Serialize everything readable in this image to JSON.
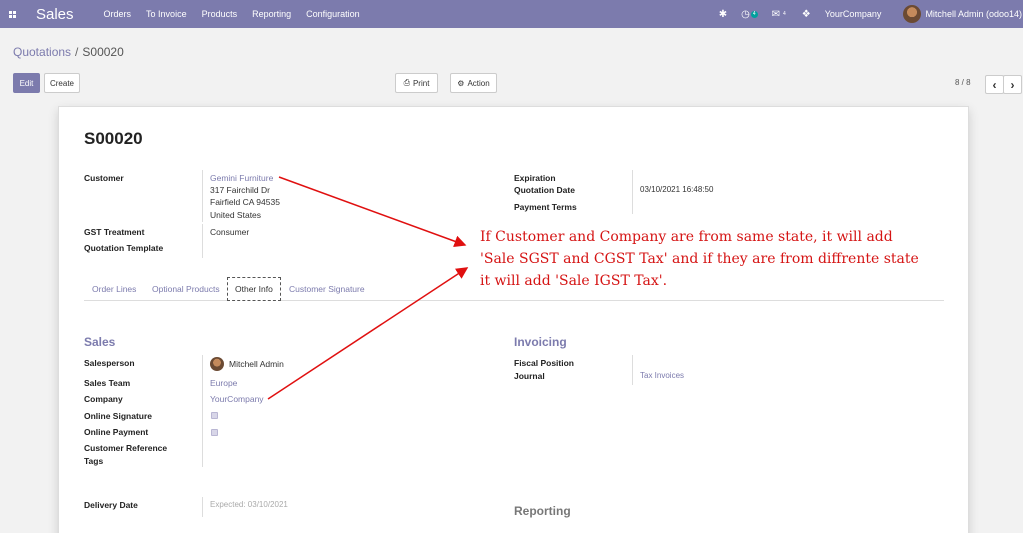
{
  "navbar": {
    "brand": "Sales",
    "menu": [
      "Orders",
      "To Invoice",
      "Products",
      "Reporting",
      "Configuration"
    ],
    "activity_count": "4",
    "message_count": "4",
    "company": "YourCompany",
    "user": "Mitchell Admin (odoo14)"
  },
  "breadcrumb": {
    "parent": "Quotations",
    "separator": "/",
    "current": "S00020"
  },
  "toolbar": {
    "edit": "Edit",
    "create": "Create",
    "print": "Print",
    "action": "Action",
    "pager": "8 / 8",
    "prev": "‹",
    "next": "›"
  },
  "record": {
    "name": "S00020",
    "customer_label": "Customer",
    "customer_name": "Gemini Furniture",
    "customer_address": [
      "317 Fairchild Dr",
      "Fairfield CA 94535",
      "United States"
    ],
    "gst_label": "GST Treatment",
    "gst_value": "Consumer",
    "template_label": "Quotation Template",
    "expiration_label": "Expiration",
    "quotation_date_label": "Quotation Date",
    "quotation_date_value": "03/10/2021 16:48:50",
    "payment_terms_label": "Payment Terms"
  },
  "tabs": [
    "Order Lines",
    "Optional Products",
    "Other Info",
    "Customer Signature"
  ],
  "sales": {
    "title": "Sales",
    "salesperson_label": "Salesperson",
    "salesperson_value": "Mitchell Admin",
    "team_label": "Sales Team",
    "team_value": "Europe",
    "company_label": "Company",
    "company_value": "YourCompany",
    "online_signature_label": "Online Signature",
    "online_payment_label": "Online Payment",
    "customer_ref_label": "Customer Reference",
    "tags_label": "Tags"
  },
  "invoicing": {
    "title": "Invoicing",
    "fiscal_label": "Fiscal Position",
    "journal_label": "Journal",
    "journal_value": "Tax Invoices"
  },
  "delivery": {
    "label": "Delivery Date",
    "value": "Expected: 03/10/2021"
  },
  "reporting": {
    "title": "Reporting"
  },
  "annotation": {
    "lines": [
      "If Customer and Company are from same state, it will add",
      "'Sale SGST and CGST Tax' and if they are from diffrente state",
      "it will add 'Sale IGST Tax'."
    ],
    "color": "#d51414"
  },
  "colors": {
    "primary": "#7c7bad",
    "accent_badge": "#00a09d"
  }
}
